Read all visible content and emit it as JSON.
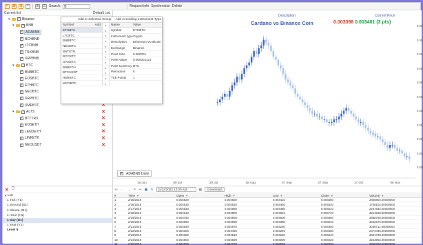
{
  "toolbar": {
    "search_label": "Search:",
    "search_value": "B",
    "links": [
      "Request info",
      "Synchronize",
      "Delete"
    ]
  },
  "tree": {
    "header_left": "Current list",
    "header_right": "Default List",
    "rows": [
      {
        "label": "Binance",
        "indent": 1,
        "folder": true,
        "checked": true,
        "expand": "▾",
        "x": false,
        "selected": false
      },
      {
        "label": "BNB",
        "indent": 2,
        "folder": true,
        "checked": true,
        "expand": "▾",
        "x": false,
        "selected": false
      },
      {
        "label": "ADABNB",
        "indent": 3,
        "folder": false,
        "checked": true,
        "expand": "",
        "x": false,
        "selected": true
      },
      {
        "label": "BCHBNB",
        "indent": 3,
        "folder": false,
        "checked": true,
        "expand": "",
        "x": false,
        "selected": false
      },
      {
        "label": "LTCBNB",
        "indent": 3,
        "folder": false,
        "checked": true,
        "expand": "",
        "x": false,
        "selected": false
      },
      {
        "label": "TRXBNB",
        "indent": 3,
        "folder": false,
        "checked": true,
        "expand": "",
        "x": false,
        "selected": false
      },
      {
        "label": "XRPBNB",
        "indent": 3,
        "folder": false,
        "checked": true,
        "expand": "",
        "x": false,
        "selected": false
      },
      {
        "label": "BTC",
        "indent": 2,
        "folder": true,
        "checked": true,
        "expand": "▾",
        "x": false,
        "selected": false
      },
      {
        "label": "BNBBTC",
        "indent": 3,
        "folder": false,
        "checked": true,
        "expand": "",
        "x": true,
        "selected": false
      },
      {
        "label": "EOSBTC",
        "indent": 3,
        "folder": false,
        "checked": true,
        "expand": "",
        "x": true,
        "selected": false
      },
      {
        "label": "ETHBTC",
        "indent": 3,
        "folder": false,
        "checked": true,
        "expand": "",
        "x": true,
        "selected": false
      },
      {
        "label": "NEOBTC",
        "indent": 3,
        "folder": false,
        "checked": true,
        "expand": "",
        "x": true,
        "selected": false
      },
      {
        "label": "XRPBTC",
        "indent": 3,
        "folder": false,
        "checked": true,
        "expand": "",
        "x": true,
        "selected": false
      },
      {
        "label": "XMRBTC",
        "indent": 3,
        "folder": false,
        "checked": true,
        "expand": "",
        "x": true,
        "selected": false
      },
      {
        "label": "ALTS",
        "indent": 2,
        "folder": true,
        "checked": true,
        "expand": "▾",
        "x": true,
        "selected": false
      },
      {
        "label": "BTTTRX",
        "indent": 3,
        "folder": false,
        "checked": true,
        "expand": "",
        "x": true,
        "selected": false
      },
      {
        "label": "EOSETH",
        "indent": 3,
        "folder": false,
        "checked": true,
        "expand": "",
        "x": true,
        "selected": false
      },
      {
        "label": "LENDETH",
        "indent": 3,
        "folder": false,
        "checked": true,
        "expand": "",
        "x": true,
        "selected": false
      },
      {
        "label": "LINKETH",
        "indent": 3,
        "folder": false,
        "checked": true,
        "expand": "",
        "x": true,
        "selected": false
      },
      {
        "label": "NEOUSDT",
        "indent": 3,
        "folder": false,
        "checked": true,
        "expand": "",
        "x": true,
        "selected": false
      }
    ]
  },
  "dropdown": {
    "top_buttons": [
      "Add to Selected Group",
      "Add According Instrument Type"
    ],
    "list_header": "Symbol",
    "list_header_right": "Add",
    "symbols": [
      "ETHBTC",
      "LTCBTC",
      "BNBBTC",
      "NEOBTC",
      "BNTETH",
      "BCCBTC",
      "GASBTC",
      "BNBETH",
      "BTCUSDT",
      "HSRBTC",
      "MCOBTC"
    ],
    "prop_headers": [
      "Name",
      "Value"
    ],
    "props": [
      [
        "Symbol",
        "ETHBTC"
      ],
      [
        "Instrument type",
        "Crypto"
      ],
      [
        "Description",
        "Ethereum vs Bitcoin"
      ],
      [
        "Exchange",
        "Binance"
      ],
      [
        "Point Size",
        "0.000001"
      ],
      [
        "Point Value",
        "0.000001121"
      ],
      [
        "Point Currency",
        "BTC"
      ],
      [
        "Precisions",
        "6"
      ],
      [
        "Tick Points",
        "1"
      ]
    ]
  },
  "chart": {
    "description_label": "Description",
    "current_price_label": "Current Price",
    "description": "Cardano vs Binance Coin",
    "price_red": "0.003398",
    "price_green": "0.003401",
    "price_pips": "(3 pts)",
    "series_checkbox": "ADABNB Daily",
    "x_ticks": [
      "19 Jun",
      "09 Jul",
      "29 Jul",
      "18 Aug",
      "07 Sep",
      "27 Sep",
      "17 Oct",
      "06 Nov"
    ],
    "y_ticks": [
      "0.0055",
      "0.0050",
      "0.0045",
      "0.0040",
      "0.0035",
      "0.0030",
      "0.0025",
      "0.0020",
      "0.0015",
      "0.0010",
      "0.0005"
    ]
  },
  "chart_data": {
    "type": "candlestick",
    "title": "Cardano vs Binance Coin",
    "xlabel": "",
    "ylabel": "",
    "x_ticks": [
      "19 Jun",
      "09 Jul",
      "29 Jul",
      "18 Aug",
      "07 Sep",
      "27 Sep",
      "17 Oct",
      "06 Nov"
    ],
    "y_ticks": [
      0.0055,
      0.005,
      0.0045,
      0.004,
      0.0035,
      0.003,
      0.0025,
      0.002,
      0.0015,
      0.001,
      0.0005
    ],
    "ylim": [
      0.0005,
      0.0055
    ],
    "close": [
      0.0028,
      0.0029,
      0.003,
      0.0031,
      0.003,
      0.0032,
      0.0034,
      0.0035,
      0.0037,
      0.0036,
      0.0038,
      0.004,
      0.0041,
      0.0042,
      0.0044,
      0.0046,
      0.0045,
      0.0047,
      0.0048,
      0.005,
      0.0049,
      0.0048,
      0.0046,
      0.0044,
      0.0043,
      0.0041,
      0.004,
      0.0038,
      0.0036,
      0.0035,
      0.0034,
      0.0033,
      0.0031,
      0.003,
      0.0029,
      0.0028,
      0.0027,
      0.0026,
      0.0025,
      0.0024,
      0.0024,
      0.0023,
      0.0023,
      0.0022,
      0.0022,
      0.0021,
      0.0021,
      0.0021,
      0.0022,
      0.0022,
      0.0023,
      0.0024,
      0.0025,
      0.0026,
      0.0025,
      0.0024,
      0.0023,
      0.0022,
      0.0021,
      0.0021,
      0.002,
      0.0019,
      0.0018,
      0.0017,
      0.0017,
      0.0016,
      0.0016,
      0.0015,
      0.0014,
      0.0013,
      0.0012,
      0.0013,
      0.0013,
      0.0012,
      0.0011,
      0.0011,
      0.001,
      0.0009,
      0.0009,
      0.0008
    ]
  },
  "bottom_left": {
    "tree_root": "List",
    "items": [
      "1 Tick (T1)",
      "1 Second (S1)",
      "1 Minute (M1)",
      "1 Hour (H1)",
      "1 Day (D1)",
      "1 Year (Y1)",
      "Level II"
    ],
    "selected_index": 4
  },
  "grid": {
    "date_value": "11/11/2023 12:00 AM",
    "download_label": "Download",
    "headers": [
      "#",
      "Time",
      "Open",
      "High",
      "Low",
      "Close",
      "Volume"
    ],
    "rows": [
      [
        "1",
        "2/15/2019",
        "0.004620",
        "0.004620",
        "0.004410",
        "0.004580",
        "2845804.00000000"
      ],
      [
        "2",
        "2/16/2019",
        "0.004530",
        "0.004610",
        "0.004450",
        "0.004520",
        "1758104.00000000"
      ],
      [
        "3",
        "2/17/2019",
        "0.004530",
        "0.004650",
        "0.004480",
        "0.004610",
        "2257832.00000000"
      ],
      [
        "4",
        "2/18/2019",
        "0.004610",
        "0.004800",
        "0.004540",
        "0.004740",
        "3214825.00000000"
      ],
      [
        "5",
        "2/19/2019",
        "0.004750",
        "0.004900",
        "0.004600",
        "0.004660",
        "3868755.00000000"
      ],
      [
        "6",
        "2/20/2019",
        "0.004660",
        "0.004690",
        "0.004380",
        "0.004540",
        "3042875.00000000"
      ],
      [
        "7",
        "2/21/2019",
        "0.004540",
        "0.004670",
        "0.004250",
        "0.004300",
        "3048711.00000000"
      ],
      [
        "8",
        "2/22/2019",
        "0.004300",
        "0.004460",
        "0.004240",
        "0.004350",
        "2474446.00000000"
      ],
      [
        "9",
        "2/23/2019",
        "0.004350",
        "0.004510",
        "0.004260",
        "0.004510",
        "2651730.00000000"
      ],
      [
        "10",
        "2/24/2019",
        "0.004500",
        "0.004590",
        "0.004000",
        "0.004020",
        "3253902.00000000"
      ],
      [
        "11",
        "2/25/2019",
        "0.004000",
        "0.004170",
        "0.003900",
        "0.004020",
        "3009728.00000000"
      ]
    ]
  },
  "colors": {
    "background": "#7f79d9",
    "up": "#3b67c4",
    "down": "#a9c3e8",
    "price_red": "#d8322a",
    "price_green": "#1c9a3a",
    "description_blue": "#3a5fa8",
    "delete_red": "#d8322a"
  }
}
